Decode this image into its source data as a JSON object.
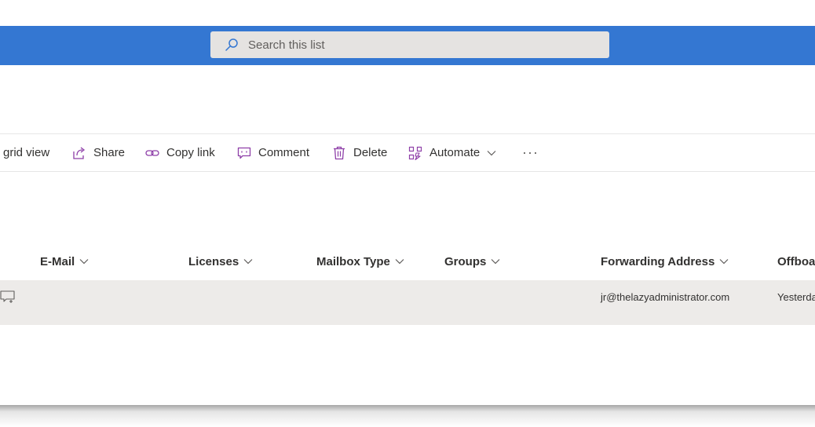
{
  "search": {
    "placeholder": "Search this list"
  },
  "command_bar": {
    "grid_view": "grid view",
    "share": "Share",
    "copy_link": "Copy link",
    "comment": "Comment",
    "delete": "Delete",
    "automate": "Automate",
    "more": "···"
  },
  "columns": [
    "E-Mail",
    "Licenses",
    "Mailbox Type",
    "Groups",
    "Forwarding Address",
    "Offboa"
  ],
  "row": {
    "forwarding_address": "jr@thelazyadministrator.com",
    "offboard_date": "Yesterda"
  },
  "colors": {
    "top_bar": "#3477d2",
    "search_bg": "#e5e3e1",
    "icon_accent": "#8e3fa8",
    "row_selected_bg": "#edebe9"
  },
  "icons": [
    "search-icon",
    "share-icon",
    "link-icon",
    "comment-icon",
    "delete-icon",
    "automate-icon",
    "chevron-down-icon",
    "add-comment-icon"
  ]
}
